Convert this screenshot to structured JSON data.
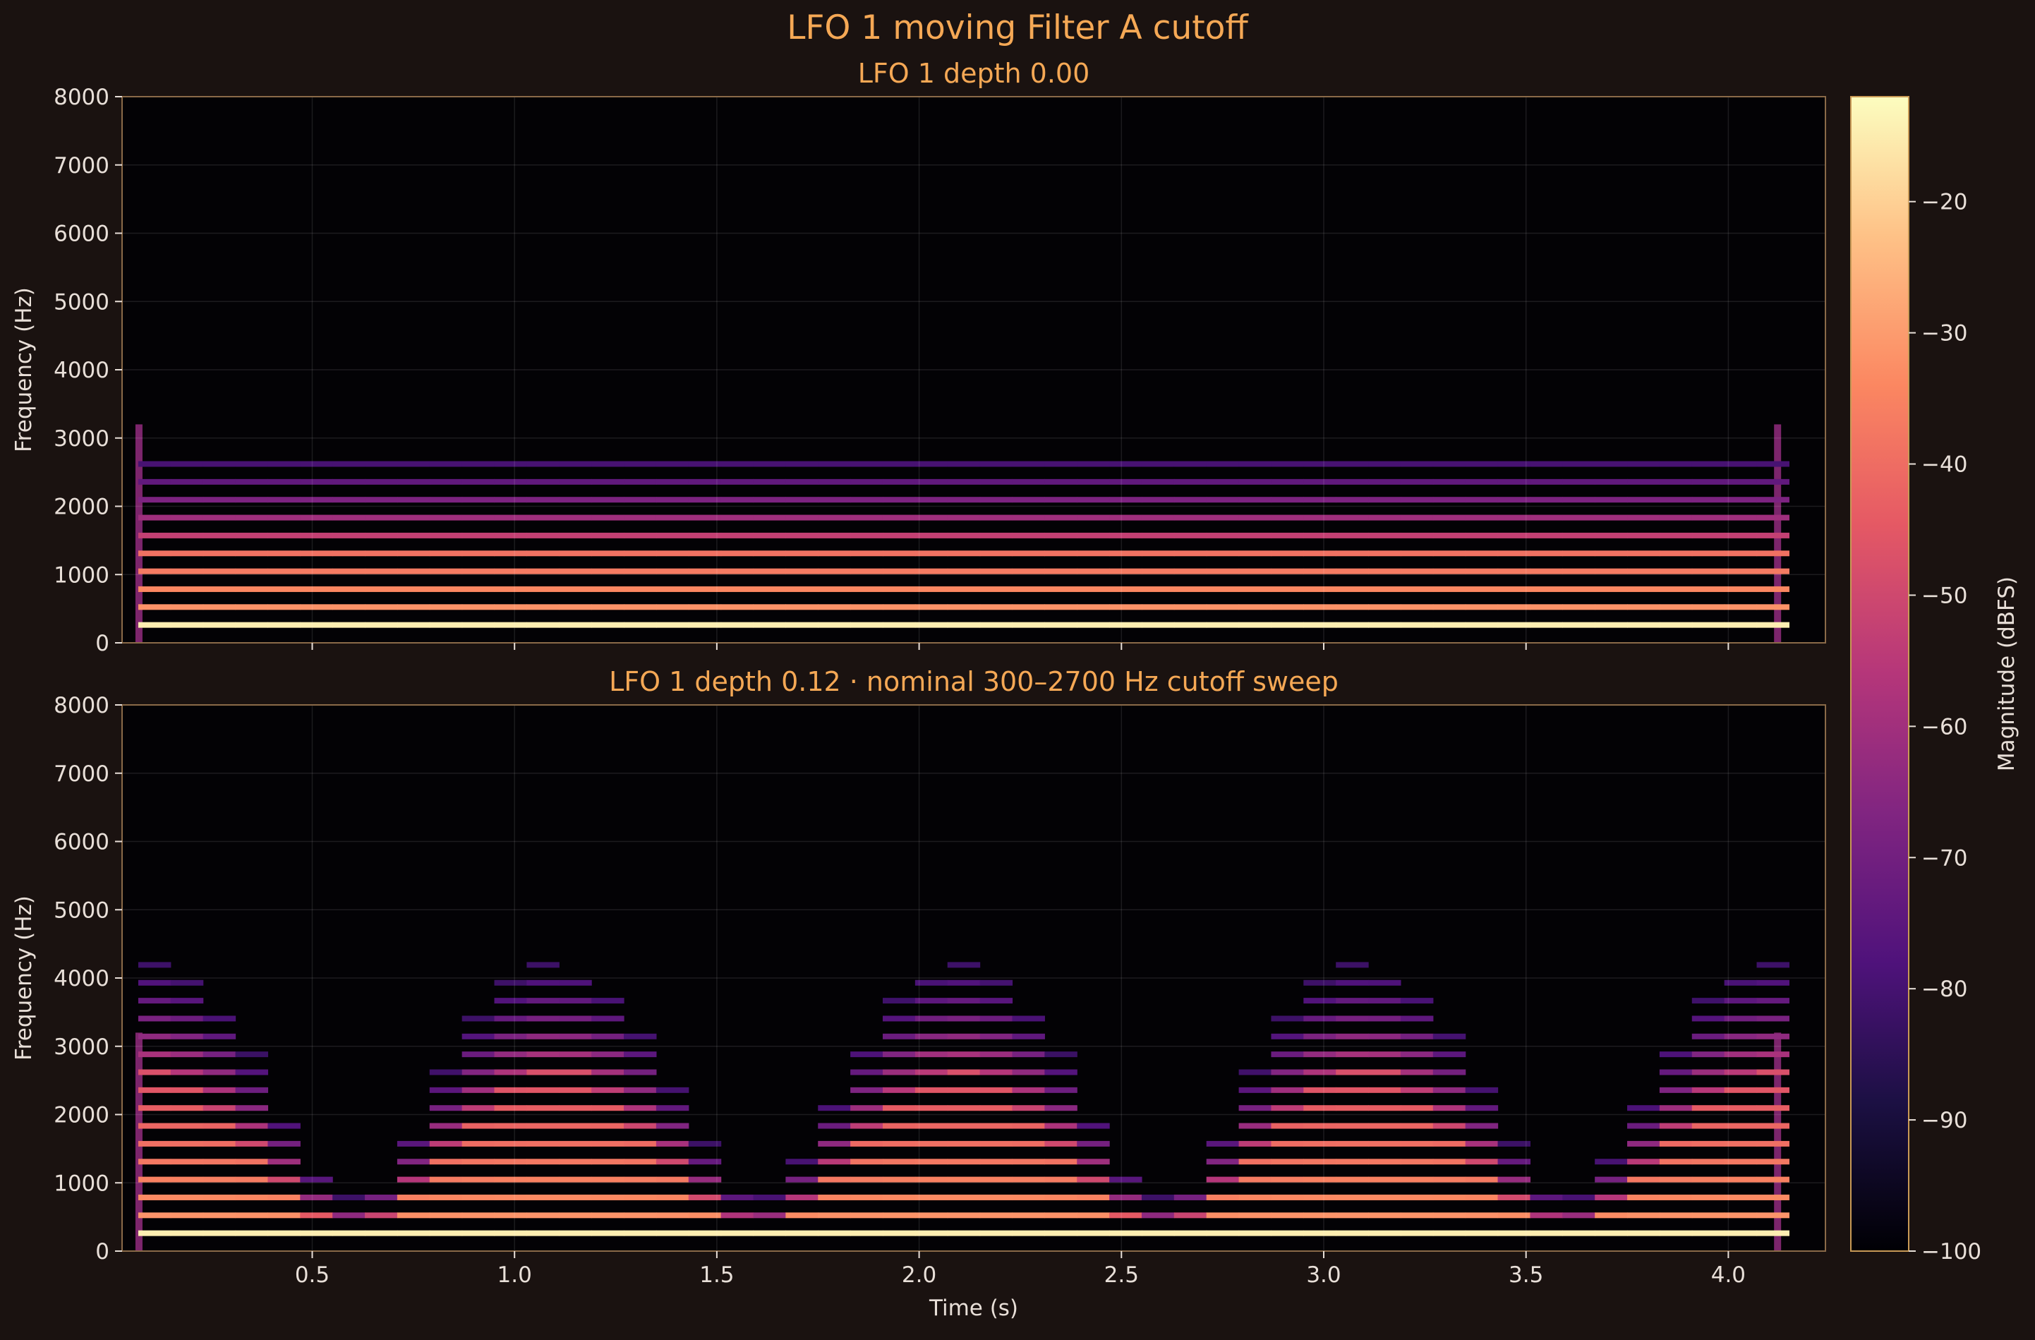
{
  "figure": {
    "suptitle": "LFO 1 moving Filter A cutoff",
    "background": "#1a1210",
    "title_color": "#f5a855",
    "text_color": "#e8dfd8",
    "spine_color": "#8a6a48"
  },
  "chart_data": [
    {
      "type": "heatmap",
      "title": "LFO 1 depth 0.00",
      "xlabel": "",
      "ylabel": "Frequency (Hz)",
      "xlim": [
        0.03,
        4.24
      ],
      "ylim": [
        0,
        8000
      ],
      "yticks": [
        0,
        1000,
        2000,
        3000,
        4000,
        5000,
        6000,
        7000,
        8000
      ],
      "xticks": [
        0.5,
        1.0,
        1.5,
        2.0,
        2.5,
        3.0,
        3.5,
        4.0
      ],
      "show_xtick_labels": false,
      "grid": true,
      "signal": {
        "onset_s": 0.07,
        "release_s": 4.12,
        "fundamental_hz": 262,
        "cutoff_model": "constant",
        "cutoff_hz": 1400,
        "visible_upper_hz": 5200
      }
    },
    {
      "type": "heatmap",
      "title": "LFO 1 depth 0.12 · nominal 300–2700 Hz cutoff sweep",
      "xlabel": "Time (s)",
      "ylabel": "Frequency (Hz)",
      "xlim": [
        0.03,
        4.24
      ],
      "ylim": [
        0,
        8000
      ],
      "yticks": [
        0,
        1000,
        2000,
        3000,
        4000,
        5000,
        6000,
        7000,
        8000
      ],
      "xticks": [
        0.5,
        1.0,
        1.5,
        2.0,
        2.5,
        3.0,
        3.5,
        4.0
      ],
      "xticklabels": [
        "0.5",
        "1.0",
        "1.5",
        "2.0",
        "2.5",
        "3.0",
        "3.5",
        "4.0"
      ],
      "show_xtick_labels": true,
      "grid": true,
      "signal": {
        "onset_s": 0.07,
        "release_s": 4.12,
        "fundamental_hz": 262,
        "cutoff_model": "lfo_sweep",
        "sweep_peaks_s": [
          0.1,
          1.1,
          2.1,
          3.1
        ],
        "sweep_troughs_s": [
          0.8,
          1.8,
          2.8,
          3.8
        ],
        "visible_upper_hz": 8000
      }
    }
  ],
  "colorbar": {
    "label": "Magnitude (dBFS)",
    "colormap": "magma",
    "range": [
      -100,
      -12
    ],
    "ticks": [
      -100,
      -90,
      -80,
      -70,
      -60,
      -50,
      -40,
      -30,
      -20
    ],
    "ticklabels": [
      "−100",
      "−90",
      "−80",
      "−70",
      "−60",
      "−50",
      "−40",
      "−30",
      "−20"
    ]
  }
}
